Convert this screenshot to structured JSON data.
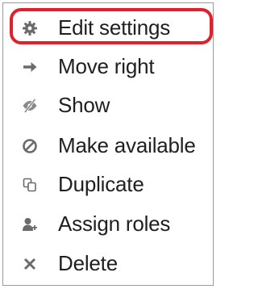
{
  "menu": {
    "items": [
      {
        "label": "Edit settings",
        "icon": "gear-icon"
      },
      {
        "label": "Move right",
        "icon": "arrow-right-icon"
      },
      {
        "label": "Show",
        "icon": "eye-slash-icon"
      },
      {
        "label": "Make available",
        "icon": "ban-icon"
      },
      {
        "label": "Duplicate",
        "icon": "copy-icon"
      },
      {
        "label": "Assign roles",
        "icon": "user-plus-icon"
      },
      {
        "label": "Delete",
        "icon": "close-icon"
      }
    ],
    "highlighted_index": 0
  },
  "colors": {
    "text": "#1f1f1f",
    "icon": "#6b6b6b",
    "highlight": "#e0202a",
    "border": "#9a9a9a"
  }
}
